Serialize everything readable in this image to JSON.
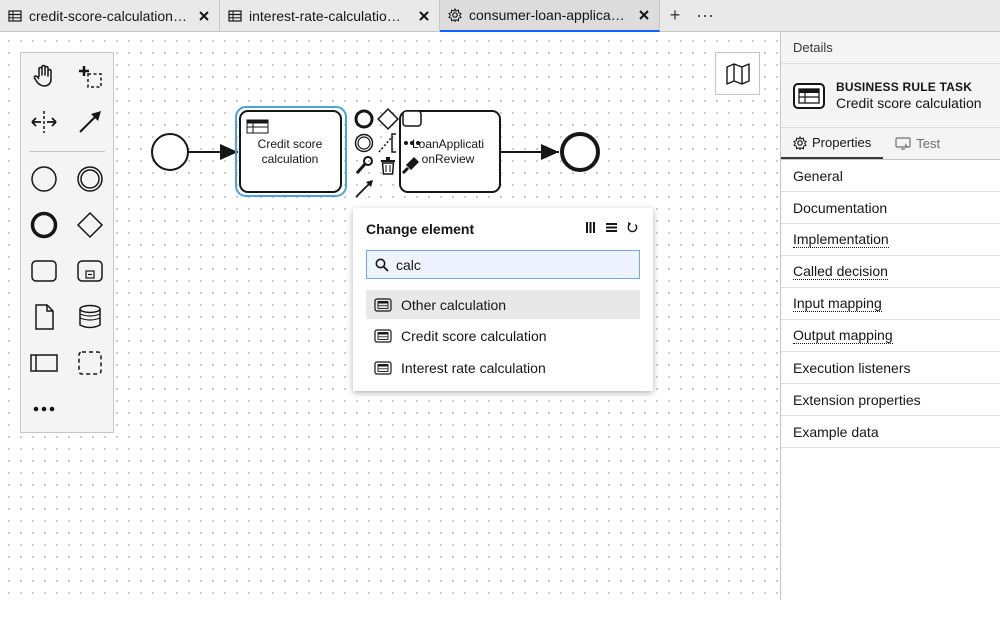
{
  "tabs": [
    {
      "label": "credit-score-calculation.dmn",
      "icon": "table-icon",
      "active": false
    },
    {
      "label": "interest-rate-calculation.dmn",
      "icon": "table-icon",
      "active": false
    },
    {
      "label": "consumer-loan-application.bpmn",
      "icon": "gear-icon",
      "active": true
    }
  ],
  "tab_actions": {
    "add": "+",
    "more": "···"
  },
  "diagram": {
    "task1": {
      "line1": "Credit score",
      "line2": "calculation"
    },
    "task2": {
      "line1": "LoanApplicati",
      "line2": "onReview"
    }
  },
  "popup": {
    "title": "Change element",
    "search_value": "calc",
    "items": [
      {
        "label": "Other calculation"
      },
      {
        "label": "Credit score calculation"
      },
      {
        "label": "Interest rate calculation"
      }
    ]
  },
  "panel": {
    "header": "Details",
    "element_type": "BUSINESS RULE TASK",
    "element_name": "Credit score calculation",
    "tabs": [
      {
        "label": "Properties",
        "active": true
      },
      {
        "label": "Test",
        "active": false
      }
    ],
    "groups": [
      {
        "label": "General",
        "dotted": false
      },
      {
        "label": "Documentation",
        "dotted": false
      },
      {
        "label": "Implementation",
        "dotted": true
      },
      {
        "label": "Called decision",
        "dotted": true
      },
      {
        "label": "Input mapping",
        "dotted": true
      },
      {
        "label": "Output mapping",
        "dotted": true
      },
      {
        "label": "Execution listeners",
        "dotted": false
      },
      {
        "label": "Extension properties",
        "dotted": false
      },
      {
        "label": "Example data",
        "dotted": false
      }
    ]
  },
  "colors": {
    "accent": "#0f62fe",
    "selection": "#4ba3dd",
    "search_bg": "#eef4ff"
  }
}
